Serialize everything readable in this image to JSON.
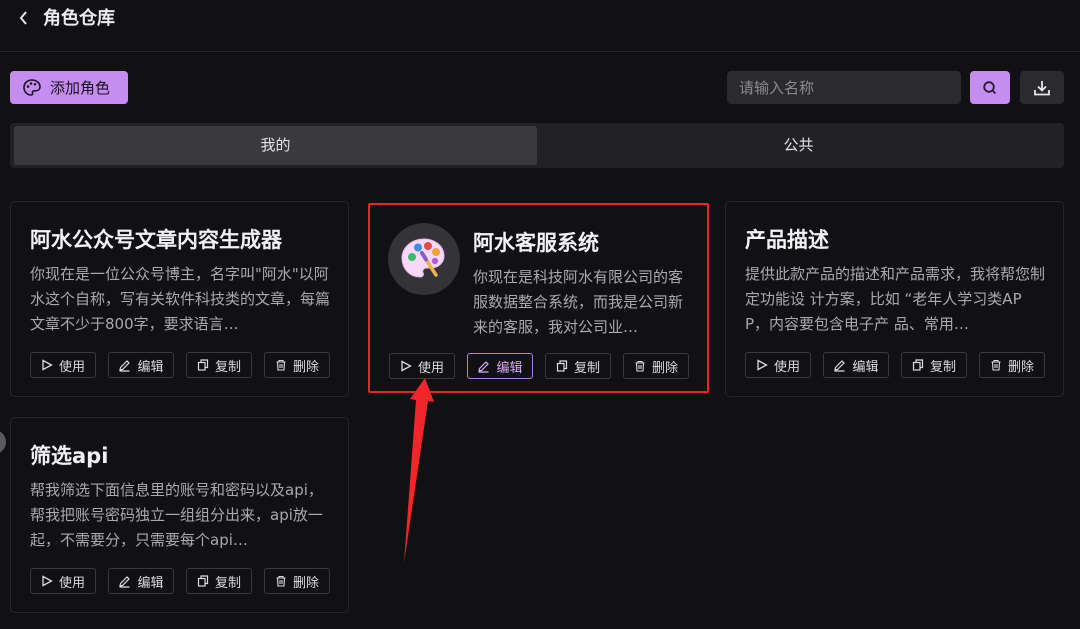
{
  "header": {
    "title": "角色仓库"
  },
  "toolbar": {
    "add_label": "添加角色",
    "search_placeholder": "请输入名称"
  },
  "tabs": [
    {
      "label": "我的",
      "active": true
    },
    {
      "label": "公共",
      "active": false
    }
  ],
  "action_labels": {
    "use": "使用",
    "edit": "编辑",
    "copy": "复制",
    "delete": "删除"
  },
  "cards": [
    {
      "title": "阿水公众号文章内容生成器",
      "desc": "你现在是一位公众号博主，名字叫\"阿水\"以阿水这个自称，写有关软件科技类的文章，每篇文章不少于800字，要求语言…",
      "avatar": null
    },
    {
      "title": "阿水客服系统",
      "desc": "你现在是科技阿水有限公司的客服数据整合系统，而我是公司新来的客服，我对公司业…",
      "avatar": "palette-icon",
      "highlighted": true
    },
    {
      "title": "产品描述",
      "desc": "提供此款产品的描述和产品需求，我将帮您制定功能设 计方案，比如 “老年人学习类APP，内容要包含电子产 品、常用…",
      "avatar": null
    },
    {
      "title": "筛选api",
      "desc": "帮我筛选下面信息里的账号和密码以及api，帮我把账号密码独立一组组分出来，api放一起，不需要分，只需要每个api…",
      "avatar": null
    }
  ],
  "colors": {
    "accent": "#c58df0",
    "highlight_border": "#e8242a",
    "background": "#111113"
  }
}
